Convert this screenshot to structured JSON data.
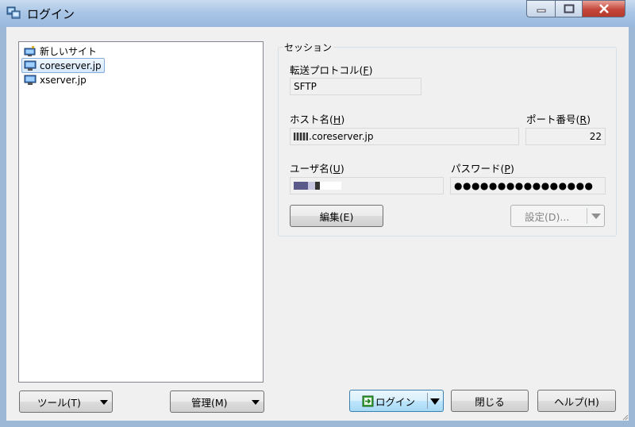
{
  "window": {
    "title": "ログイン"
  },
  "sites": [
    {
      "label": "新しいサイト",
      "icon": "new-site-icon",
      "selected": false
    },
    {
      "label": "coreserver.jp",
      "icon": "computer-icon",
      "selected": true
    },
    {
      "label": "xserver.jp",
      "icon": "computer-icon",
      "selected": false
    }
  ],
  "session": {
    "group_label": "セッション",
    "protocol_label": "転送プロトコル",
    "protocol_key": "F",
    "protocol_value": "SFTP",
    "host_label": "ホスト名",
    "host_key": "H",
    "host_value": ".coreserver.jp",
    "port_label": "ポート番号",
    "port_key": "R",
    "port_value": "22",
    "user_label": "ユーザ名",
    "user_key": "U",
    "password_label": "パスワード",
    "password_key": "P",
    "password_value": "●●●●●●●●●●●●●●●●",
    "edit_button": "編集(E)",
    "advanced_button": "設定(D)..."
  },
  "footer": {
    "tools_button": "ツール(T)",
    "manage_button": "管理(M)",
    "login_button": "ログイン",
    "close_button": "閉じる",
    "help_button": "ヘルプ(H)"
  }
}
